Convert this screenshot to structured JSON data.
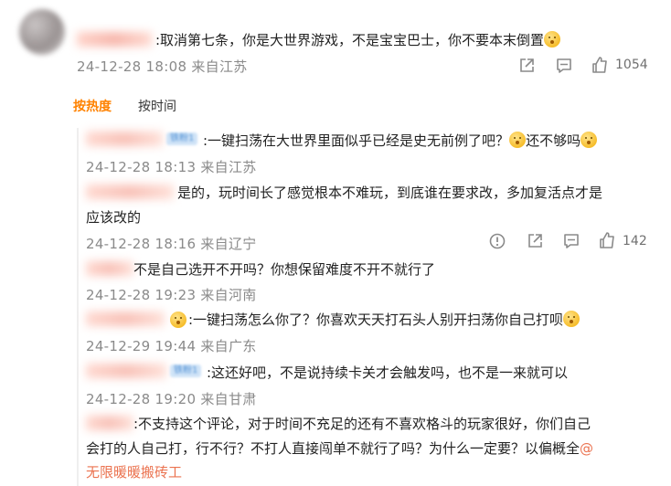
{
  "main_comment": {
    "text": ":取消第七条，你是大世界游戏，不是宝宝巴士，你不要本末倒置",
    "meta": "24-12-28 18:08 来自江苏",
    "like_count": "1054"
  },
  "tabs": {
    "hot": "按热度",
    "time": "按时间"
  },
  "replies": [
    {
      "badge": "铁粉1",
      "text": ":一键扫荡在大世界里面似乎已经是史无前例了吧？",
      "text_tail": "还不够吗",
      "meta": "24-12-28 18:13 来自江苏"
    },
    {
      "text_line1": "是的，玩时间长了感觉根本不难玩，到底谁在要求改，多加复活点才是",
      "text_line2": "应该改的",
      "meta": "24-12-28 18:16 来自辽宁",
      "like_count": "142"
    },
    {
      "text": "不是自己选开不开吗？你想保留难度不开不就行了",
      "meta": "24-12-28 19:23 来自河南"
    },
    {
      "text": ":一键扫荡怎么你了？你喜欢天天打石头人别开扫荡你自己打呗",
      "meta": "24-12-29 19:44 来自广东"
    },
    {
      "badge": "铁粉1",
      "text": ":这还好吧，不是说持续卡关才会触发吗，也不是一来就可以",
      "meta": "24-12-28 19:20 来自甘肃"
    },
    {
      "text_line1": ":不支持这个评论，对于时间不充足的还有不喜欢格斗的玩家很好，你们自己",
      "text_line2": "会打的人自己打，行不行？不打人直接闯单不就行了吗？为什么一定要？以偏概全",
      "mention_at": "@",
      "mention": "无限暖暖搬砖工"
    }
  ],
  "icons": [
    "share-icon",
    "comment-icon",
    "like-icon",
    "report-icon"
  ],
  "colors": {
    "accent": "#ff8200",
    "link": "#eb7350",
    "meta": "#8a8a8a"
  }
}
